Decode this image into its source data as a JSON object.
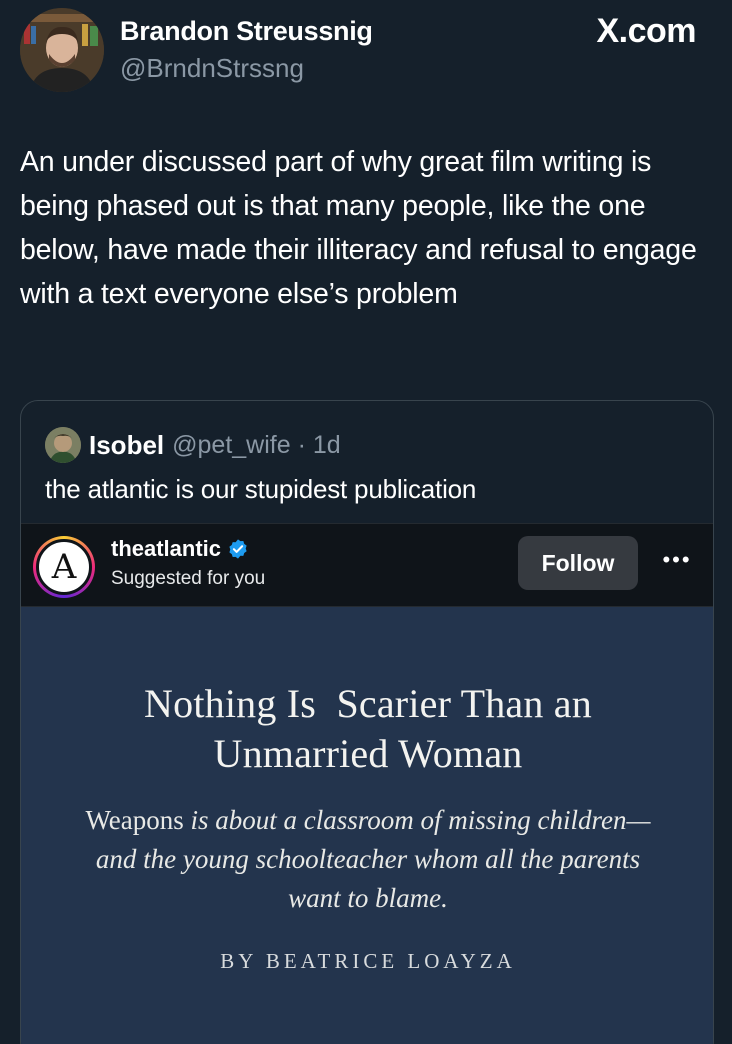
{
  "tweet": {
    "author_name": "Brandon Streussnig",
    "author_handle": "@BrndnStrssng",
    "site_mark": "X.com",
    "text": "An under discussed part of why great film writing is being phased out is that many people, like the one below, have made their illiteracy and refusal to engage with a text everyone else’s problem"
  },
  "quote": {
    "name": "Isobel",
    "handle_time": "@pet_wife · 1d",
    "text": "the atlantic is our stupidest publication"
  },
  "embed": {
    "account": "theatlantic",
    "subtitle": "Suggested for you",
    "follow_label": "Follow",
    "avatar_letter": "A",
    "more_label": "•••",
    "article": {
      "title_line1": "Nothing Is  Scarier Than an",
      "title_line2": "Unmarried Woman",
      "deck_start": "Weapons",
      "deck_rest": " is about a classroom of missing children—and the young schoolteacher whom all the parents want to blame.",
      "byline": "BY BEATRICE LOAYZA"
    }
  },
  "colors": {
    "background": "#15202b",
    "secondary_text": "#8b98a5",
    "article_bg": "#23344d",
    "verified": "#1d9bf0"
  }
}
